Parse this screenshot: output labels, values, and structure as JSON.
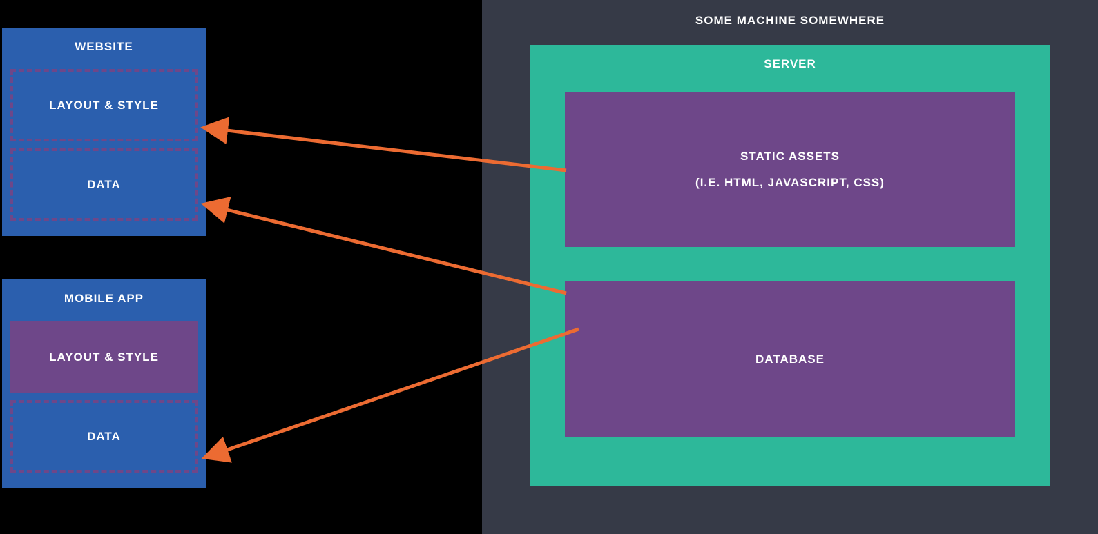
{
  "machine": {
    "title": "SOME MACHINE SOMEWHERE",
    "server": {
      "title": "SERVER",
      "static_assets": {
        "line1": "STATIC ASSETS",
        "line2": "(I.E. HTML, JAVASCRIPT, CSS)"
      },
      "database": "DATABASE"
    }
  },
  "clients": {
    "website": {
      "title": "WEBSITE",
      "layout": "LAYOUT & STYLE",
      "data": "DATA"
    },
    "mobile": {
      "title": "MOBILE APP",
      "layout": "LAYOUT & STYLE",
      "data": "DATA"
    }
  },
  "colors": {
    "arrow": "#ec6b32",
    "blue": "#2b5fae",
    "purple": "#6e4789",
    "teal": "#2db89a",
    "dark": "#363a47"
  }
}
